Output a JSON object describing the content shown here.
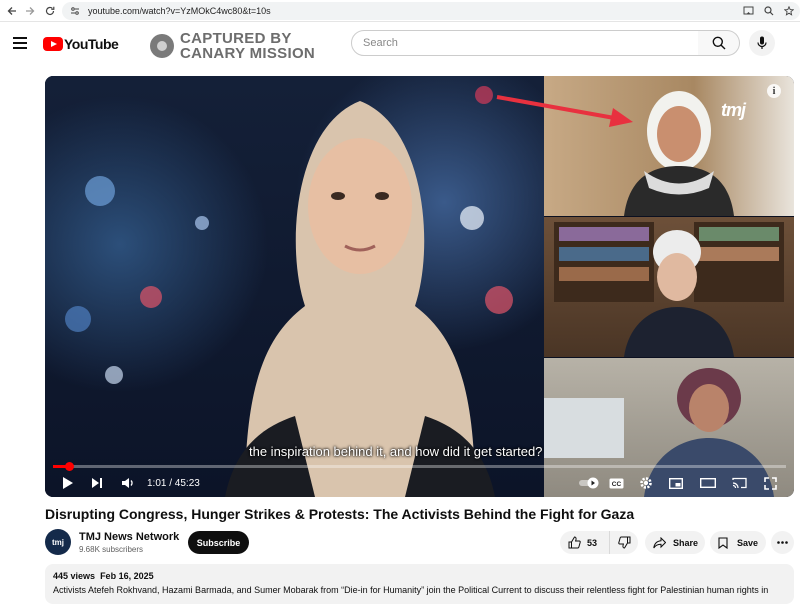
{
  "browser": {
    "url": "youtube.com/watch?v=YzMOkC4wc80&t=10s"
  },
  "header": {
    "logo_text": "YouTube",
    "watermark_line1": "CAPTURED BY",
    "watermark_line2": "CANARY MISSION",
    "search_placeholder": "Search"
  },
  "video": {
    "subtitle": "the inspiration behind it, and how did it get started?",
    "time": "1:01 / 45:23",
    "progress_fraction": 0.0224,
    "overlay_logo": "tmj"
  },
  "meta": {
    "title": "Disrupting Congress, Hunger Strikes & Protests: The Activists Behind the Fight for Gaza",
    "channel_name": "TMJ News Network",
    "channel_avatar": "tmj",
    "subscribers": "9.68K subscribers",
    "subscribe_label": "Subscribe",
    "likes": "53",
    "share_label": "Share",
    "save_label": "Save",
    "views": "445 views",
    "date": "Feb 16, 2025",
    "description": "Activists Atefeh Rokhvand, Hazami Barmada, and Sumer Mobarak from “Die-in for Humanity” join the Political Current to discuss their relentless fight for Palestinian human rights in"
  },
  "icons": {
    "back": "arrow-left-icon",
    "forward": "arrow-right-icon",
    "reload": "reload-icon",
    "site_info": "tune-icon",
    "search": "search-icon",
    "mic": "mic-icon",
    "menu": "hamburger-icon"
  },
  "colors": {
    "brand_red": "#ff0000",
    "annotation_arrow": "#e8313f"
  }
}
